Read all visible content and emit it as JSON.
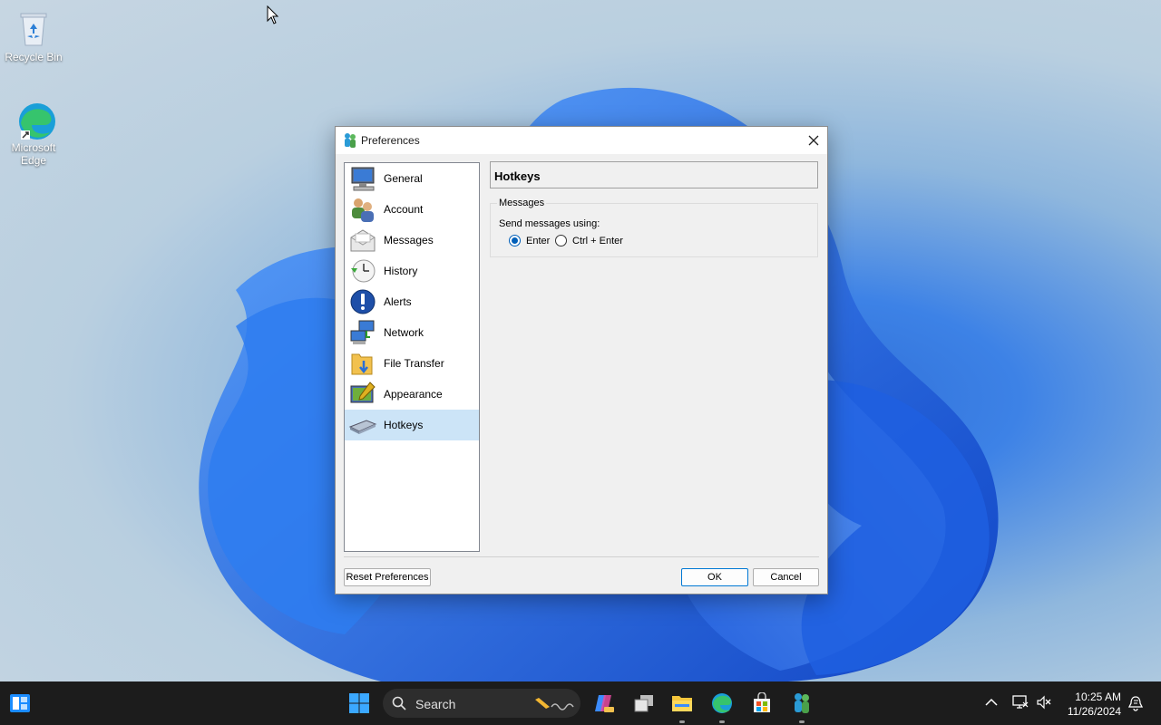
{
  "desktop": {
    "icons": [
      {
        "label": "Recycle Bin"
      },
      {
        "label": "Microsoft Edge"
      }
    ]
  },
  "dialog": {
    "title": "Preferences",
    "nav_items": [
      {
        "label": "General",
        "icon": "monitor-icon"
      },
      {
        "label": "Account",
        "icon": "users-icon"
      },
      {
        "label": "Messages",
        "icon": "envelope-icon"
      },
      {
        "label": "History",
        "icon": "clock-icon"
      },
      {
        "label": "Alerts",
        "icon": "exclamation-icon"
      },
      {
        "label": "Network",
        "icon": "network-icon"
      },
      {
        "label": "File Transfer",
        "icon": "folder-icon"
      },
      {
        "label": "Appearance",
        "icon": "appearance-icon"
      },
      {
        "label": "Hotkeys",
        "icon": "keyboard-icon"
      }
    ],
    "selected_item": "Hotkeys",
    "section_title": "Hotkeys",
    "group_label": "Messages",
    "send_label": "Send messages using:",
    "options": [
      {
        "label": "Enter",
        "checked": true
      },
      {
        "label": "Ctrl + Enter",
        "checked": false
      }
    ],
    "buttons": {
      "reset": "Reset Preferences",
      "ok": "OK",
      "cancel": "Cancel"
    }
  },
  "taskbar": {
    "search_placeholder": "Search",
    "time": "10:25 AM",
    "date": "11/26/2024"
  },
  "colors": {
    "accent": "#0078d4",
    "selection": "#cce4f7",
    "taskbar": "#1c1c1c"
  }
}
